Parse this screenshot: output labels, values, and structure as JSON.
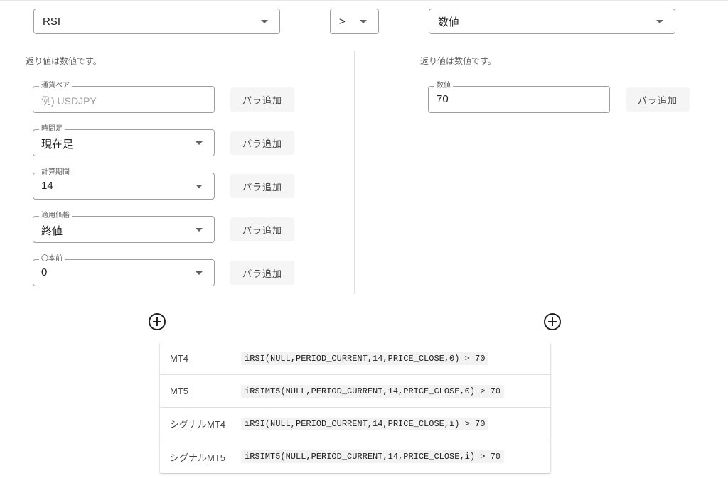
{
  "condition": {
    "left_indicator": "RSI",
    "operator": ">",
    "right_type": "数値"
  },
  "left": {
    "return_note": "返り値は数値です。",
    "add_param_label": "パラ追加",
    "params": [
      {
        "label": "通貨ペア",
        "value": "",
        "placeholder": "例) USDJPY"
      },
      {
        "label": "時間足",
        "value": "現在足"
      },
      {
        "label": "計算期間",
        "value": "14"
      },
      {
        "label": "適用価格",
        "value": "終値"
      },
      {
        "label": "〇本前",
        "value": "0"
      }
    ]
  },
  "right": {
    "return_note": "返り値は数値です。",
    "add_param_label": "パラ追加",
    "params": [
      {
        "label": "数値",
        "value": "70"
      }
    ]
  },
  "code_table": [
    {
      "platform": "MT4",
      "code": "iRSI(NULL,PERIOD_CURRENT,14,PRICE_CLOSE,0) > 70"
    },
    {
      "platform": "MT5",
      "code": "iRSIMT5(NULL,PERIOD_CURRENT,14,PRICE_CLOSE,0) > 70"
    },
    {
      "platform": "シグナルMT4",
      "code": "iRSI(NULL,PERIOD_CURRENT,14,PRICE_CLOSE,i) > 70"
    },
    {
      "platform": "シグナルMT5",
      "code": "iRSIMT5(NULL,PERIOD_CURRENT,14,PRICE_CLOSE,i) > 70"
    }
  ],
  "icons": {
    "dropdown": "caret-down-icon",
    "add": "add-circle-icon"
  },
  "colors": {
    "border": "#9e9e9e",
    "button_bg": "#f5f5f5",
    "code_bg": "#f2f2f2",
    "text": "#212121"
  }
}
